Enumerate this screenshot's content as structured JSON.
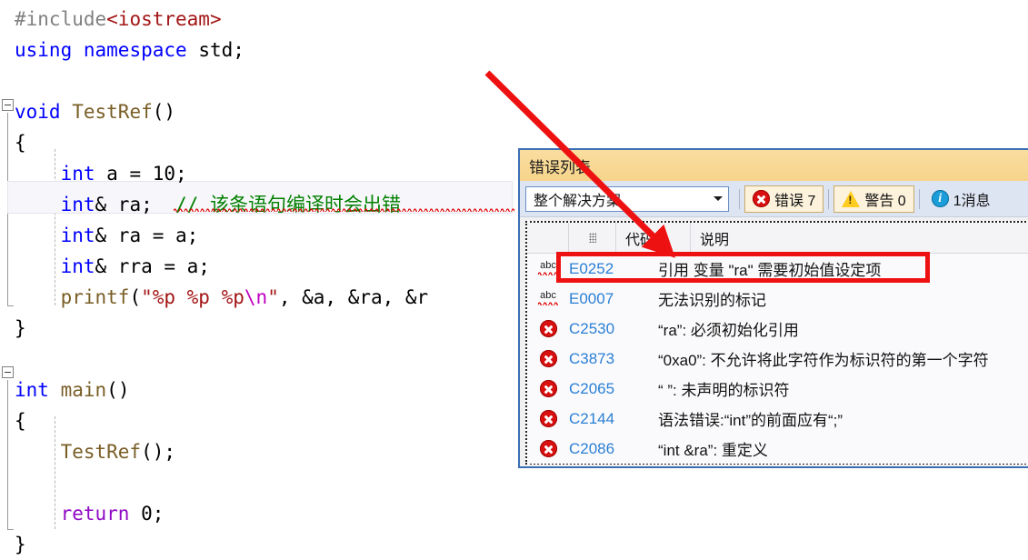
{
  "editor": {
    "lines": [
      {
        "indent": 0,
        "tokens": [
          {
            "t": "#include",
            "c": "pre"
          },
          {
            "t": "<iostream>",
            "c": "header"
          }
        ]
      },
      {
        "indent": 0,
        "tokens": [
          {
            "t": "using",
            "c": "kw"
          },
          {
            "t": " ",
            "c": "plain"
          },
          {
            "t": "namespace",
            "c": "kw"
          },
          {
            "t": " ",
            "c": "plain"
          },
          {
            "t": "std",
            "c": "plain"
          },
          {
            "t": ";",
            "c": "plain"
          }
        ]
      },
      {
        "indent": 0,
        "tokens": []
      },
      {
        "indent": 0,
        "tokens": [
          {
            "t": "void",
            "c": "kw"
          },
          {
            "t": " ",
            "c": "plain"
          },
          {
            "t": "TestRef",
            "c": "fn"
          },
          {
            "t": "()",
            "c": "plain"
          }
        ]
      },
      {
        "indent": 0,
        "tokens": [
          {
            "t": "{",
            "c": "plain"
          }
        ]
      },
      {
        "indent": 1,
        "tokens": [
          {
            "t": "int",
            "c": "type"
          },
          {
            "t": " a = ",
            "c": "plain"
          },
          {
            "t": "10",
            "c": "plain"
          },
          {
            "t": ";",
            "c": "plain"
          }
        ]
      },
      {
        "indent": 1,
        "tokens": [
          {
            "t": "int",
            "c": "type"
          },
          {
            "t": "& ra;  ",
            "c": "plain"
          },
          {
            "t": "// 该条语句编译时会出错",
            "c": "comment"
          }
        ]
      },
      {
        "indent": 1,
        "tokens": [
          {
            "t": "int",
            "c": "type"
          },
          {
            "t": "& ra = a;",
            "c": "plain"
          }
        ]
      },
      {
        "indent": 1,
        "tokens": [
          {
            "t": "int",
            "c": "type"
          },
          {
            "t": "& rra = a;",
            "c": "plain"
          }
        ]
      },
      {
        "indent": 1,
        "tokens": [
          {
            "t": "printf",
            "c": "fn"
          },
          {
            "t": "(",
            "c": "plain"
          },
          {
            "t": "\"%p %p %p",
            "c": "str"
          },
          {
            "t": "\\n",
            "c": "esc"
          },
          {
            "t": "\"",
            "c": "str"
          },
          {
            "t": ", &a, &ra, &r",
            "c": "plain"
          }
        ]
      },
      {
        "indent": 0,
        "tokens": [
          {
            "t": "}",
            "c": "plain"
          }
        ]
      },
      {
        "indent": 0,
        "tokens": []
      },
      {
        "indent": 0,
        "tokens": [
          {
            "t": "int",
            "c": "type"
          },
          {
            "t": " ",
            "c": "plain"
          },
          {
            "t": "main",
            "c": "fn"
          },
          {
            "t": "()",
            "c": "plain"
          }
        ]
      },
      {
        "indent": 0,
        "tokens": [
          {
            "t": "{",
            "c": "plain"
          }
        ]
      },
      {
        "indent": 1,
        "tokens": [
          {
            "t": "TestRef",
            "c": "fn"
          },
          {
            "t": "();",
            "c": "plain"
          }
        ]
      },
      {
        "indent": 0,
        "tokens": []
      },
      {
        "indent": 1,
        "tokens": [
          {
            "t": "return",
            "c": "ctrl"
          },
          {
            "t": " ",
            "c": "plain"
          },
          {
            "t": "0",
            "c": "plain"
          },
          {
            "t": ";",
            "c": "plain"
          }
        ]
      },
      {
        "indent": 0,
        "tokens": [
          {
            "t": "}",
            "c": "plain"
          }
        ]
      }
    ]
  },
  "error_panel": {
    "title": "错误列表",
    "scope_dropdown": {
      "selected": "整个解决方案",
      "options": [
        "整个解决方案"
      ]
    },
    "toolbar": {
      "errors_label": "错误 7",
      "warnings_label": "警告 0",
      "messages_label": "1消息",
      "errors_count": 7,
      "warnings_count": 0,
      "messages_count": 1
    },
    "columns": [
      "",
      "",
      "代码",
      "说明"
    ],
    "rows": [
      {
        "icon": "abc-squiggle-icon",
        "code": "E0252",
        "description": "引用 变量 \"ra\" 需要初始值设定项"
      },
      {
        "icon": "abc-squiggle-icon",
        "code": "E0007",
        "description": "无法识别的标记"
      },
      {
        "icon": "error-icon",
        "code": "C2530",
        "description": "“ra”: 必须初始化引用"
      },
      {
        "icon": "error-icon",
        "code": "C3873",
        "description": "“0xa0”: 不允许将此字符作为标识符的第一个字符"
      },
      {
        "icon": "error-icon",
        "code": "C2065",
        "description": "“ ”: 未声明的标识符"
      },
      {
        "icon": "error-icon",
        "code": "C2144",
        "description": "语法错误:“int”的前面应有“;”"
      },
      {
        "icon": "error-icon",
        "code": "C2086",
        "description": "“int &ra”: 重定义"
      }
    ]
  },
  "annotations": {
    "arrow_color": "#ee1111",
    "highlight_color": "#ee1111"
  }
}
